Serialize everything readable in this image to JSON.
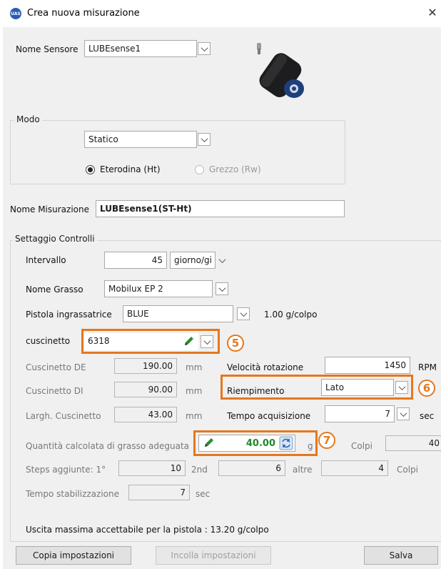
{
  "window": {
    "title": "Crea nuova misurazione",
    "app_icon_text": "UAS",
    "close_glyph": "✕"
  },
  "sensor": {
    "label": "Nome Sensore",
    "value": "LUBEsense1"
  },
  "modo": {
    "group_title": "Modo",
    "value": "Statico",
    "radio_1": {
      "label": "Eterodina (Ht)",
      "selected": true
    },
    "radio_2": {
      "label": "Grezzo (Rw)",
      "selected": false
    }
  },
  "misurazione": {
    "label": "Nome Misurazione",
    "value": "LUBEsense1(ST-Ht)"
  },
  "settaggio": {
    "group_title": "Settaggio Controlli",
    "intervallo": {
      "label": "Intervallo",
      "value": "45",
      "unit": "giorno/gi"
    },
    "grasso": {
      "label": "Nome Grasso",
      "value": "Mobilux EP 2"
    },
    "pistola": {
      "label": "Pistola ingrassatrice",
      "value": "BLUE",
      "rate": "1.00 g/colpo"
    },
    "cuscinetto": {
      "label": "cuscinetto",
      "value": "6318"
    },
    "cuscinetto_de": {
      "label": "Cuscinetto DE",
      "value": "190.00",
      "unit": "mm"
    },
    "cuscinetto_di": {
      "label": "Cuscinetto DI",
      "value": "90.00",
      "unit": "mm"
    },
    "largh": {
      "label": "Largh.  Cuscinetto",
      "value": "43.00",
      "unit": "mm"
    },
    "velocita": {
      "label": "Velocità rotazione",
      "value": "1450",
      "unit": "RPM"
    },
    "riempimento": {
      "label": "Riempimento",
      "value": "Lato"
    },
    "tempo_acq": {
      "label": "Tempo acquisizione",
      "value": "7",
      "unit": "sec"
    },
    "quantita": {
      "label": "Quantità calcolata di grasso adeguata",
      "value": "40.00",
      "unit": "g",
      "colpi_label": "Colpi",
      "colpi_value": "40"
    },
    "steps": {
      "label": "Steps aggiunte:  1°",
      "v1": "10",
      "second_label": "2nd",
      "v2": "6",
      "altre_label": "altre",
      "v3": "4",
      "colpi_label": "Colpi"
    },
    "stabilizzazione": {
      "label": "Tempo stabilizzazione",
      "value": "7",
      "unit": "sec"
    },
    "uscita": "Uscita massima accettabile per la pistola :  13.20 g/colpo"
  },
  "callouts": {
    "c5": "5",
    "c6": "6",
    "c7": "7"
  },
  "buttons": {
    "copia": "Copia impostazioni",
    "incolla": "Incolla impostazioni",
    "salva": "Salva"
  },
  "colors": {
    "callout": "#e4781e",
    "quantity_text": "#1f8a2a",
    "app_icon": "#2a5db0"
  }
}
